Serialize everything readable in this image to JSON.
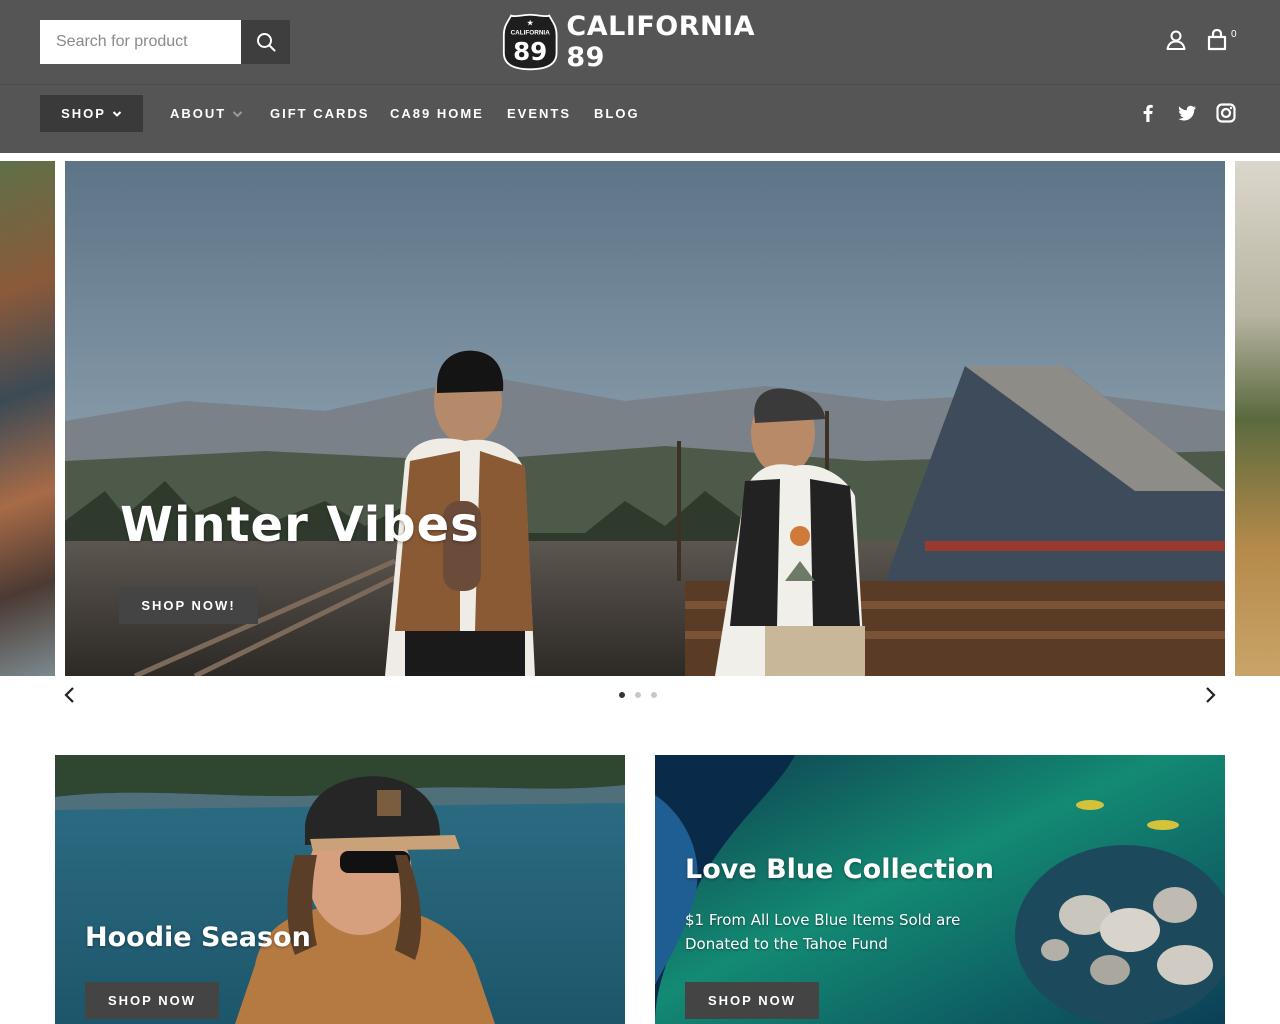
{
  "header": {
    "search": {
      "placeholder": "Search for product",
      "value": ""
    },
    "logo": {
      "badge_top": "CALIFORNIA",
      "badge_number": "89",
      "text": "CALIFORNIA 89"
    },
    "cart": {
      "count": "0"
    },
    "icons": [
      "search-icon",
      "account-icon",
      "cart-icon"
    ]
  },
  "nav": {
    "items": [
      {
        "label": "SHOP",
        "dropdown": true
      },
      {
        "label": "ABOUT",
        "dropdown": true
      },
      {
        "label": "GIFT CARDS",
        "dropdown": false
      },
      {
        "label": "CA89 HOME",
        "dropdown": false
      },
      {
        "label": "EVENTS",
        "dropdown": false
      },
      {
        "label": "BLOG",
        "dropdown": false
      }
    ],
    "social": [
      "facebook-icon",
      "twitter-icon",
      "instagram-icon"
    ]
  },
  "hero": {
    "slides": [
      {
        "title": "Winter Vibes",
        "button": "SHOP NOW!"
      }
    ],
    "slide_count": 3,
    "active_slide": 1
  },
  "promos": [
    {
      "title": "Hoodie Season",
      "subtitle": "",
      "button": "SHOP NOW"
    },
    {
      "title": "Love Blue Collection",
      "subtitle": "$1 From All Love Blue Items Sold are Donated to the Tahoe Fund",
      "button": "SHOP NOW"
    }
  ],
  "colors": {
    "header_bg": "#555555",
    "button_dark": "#444444",
    "text_light": "#ffffff"
  }
}
